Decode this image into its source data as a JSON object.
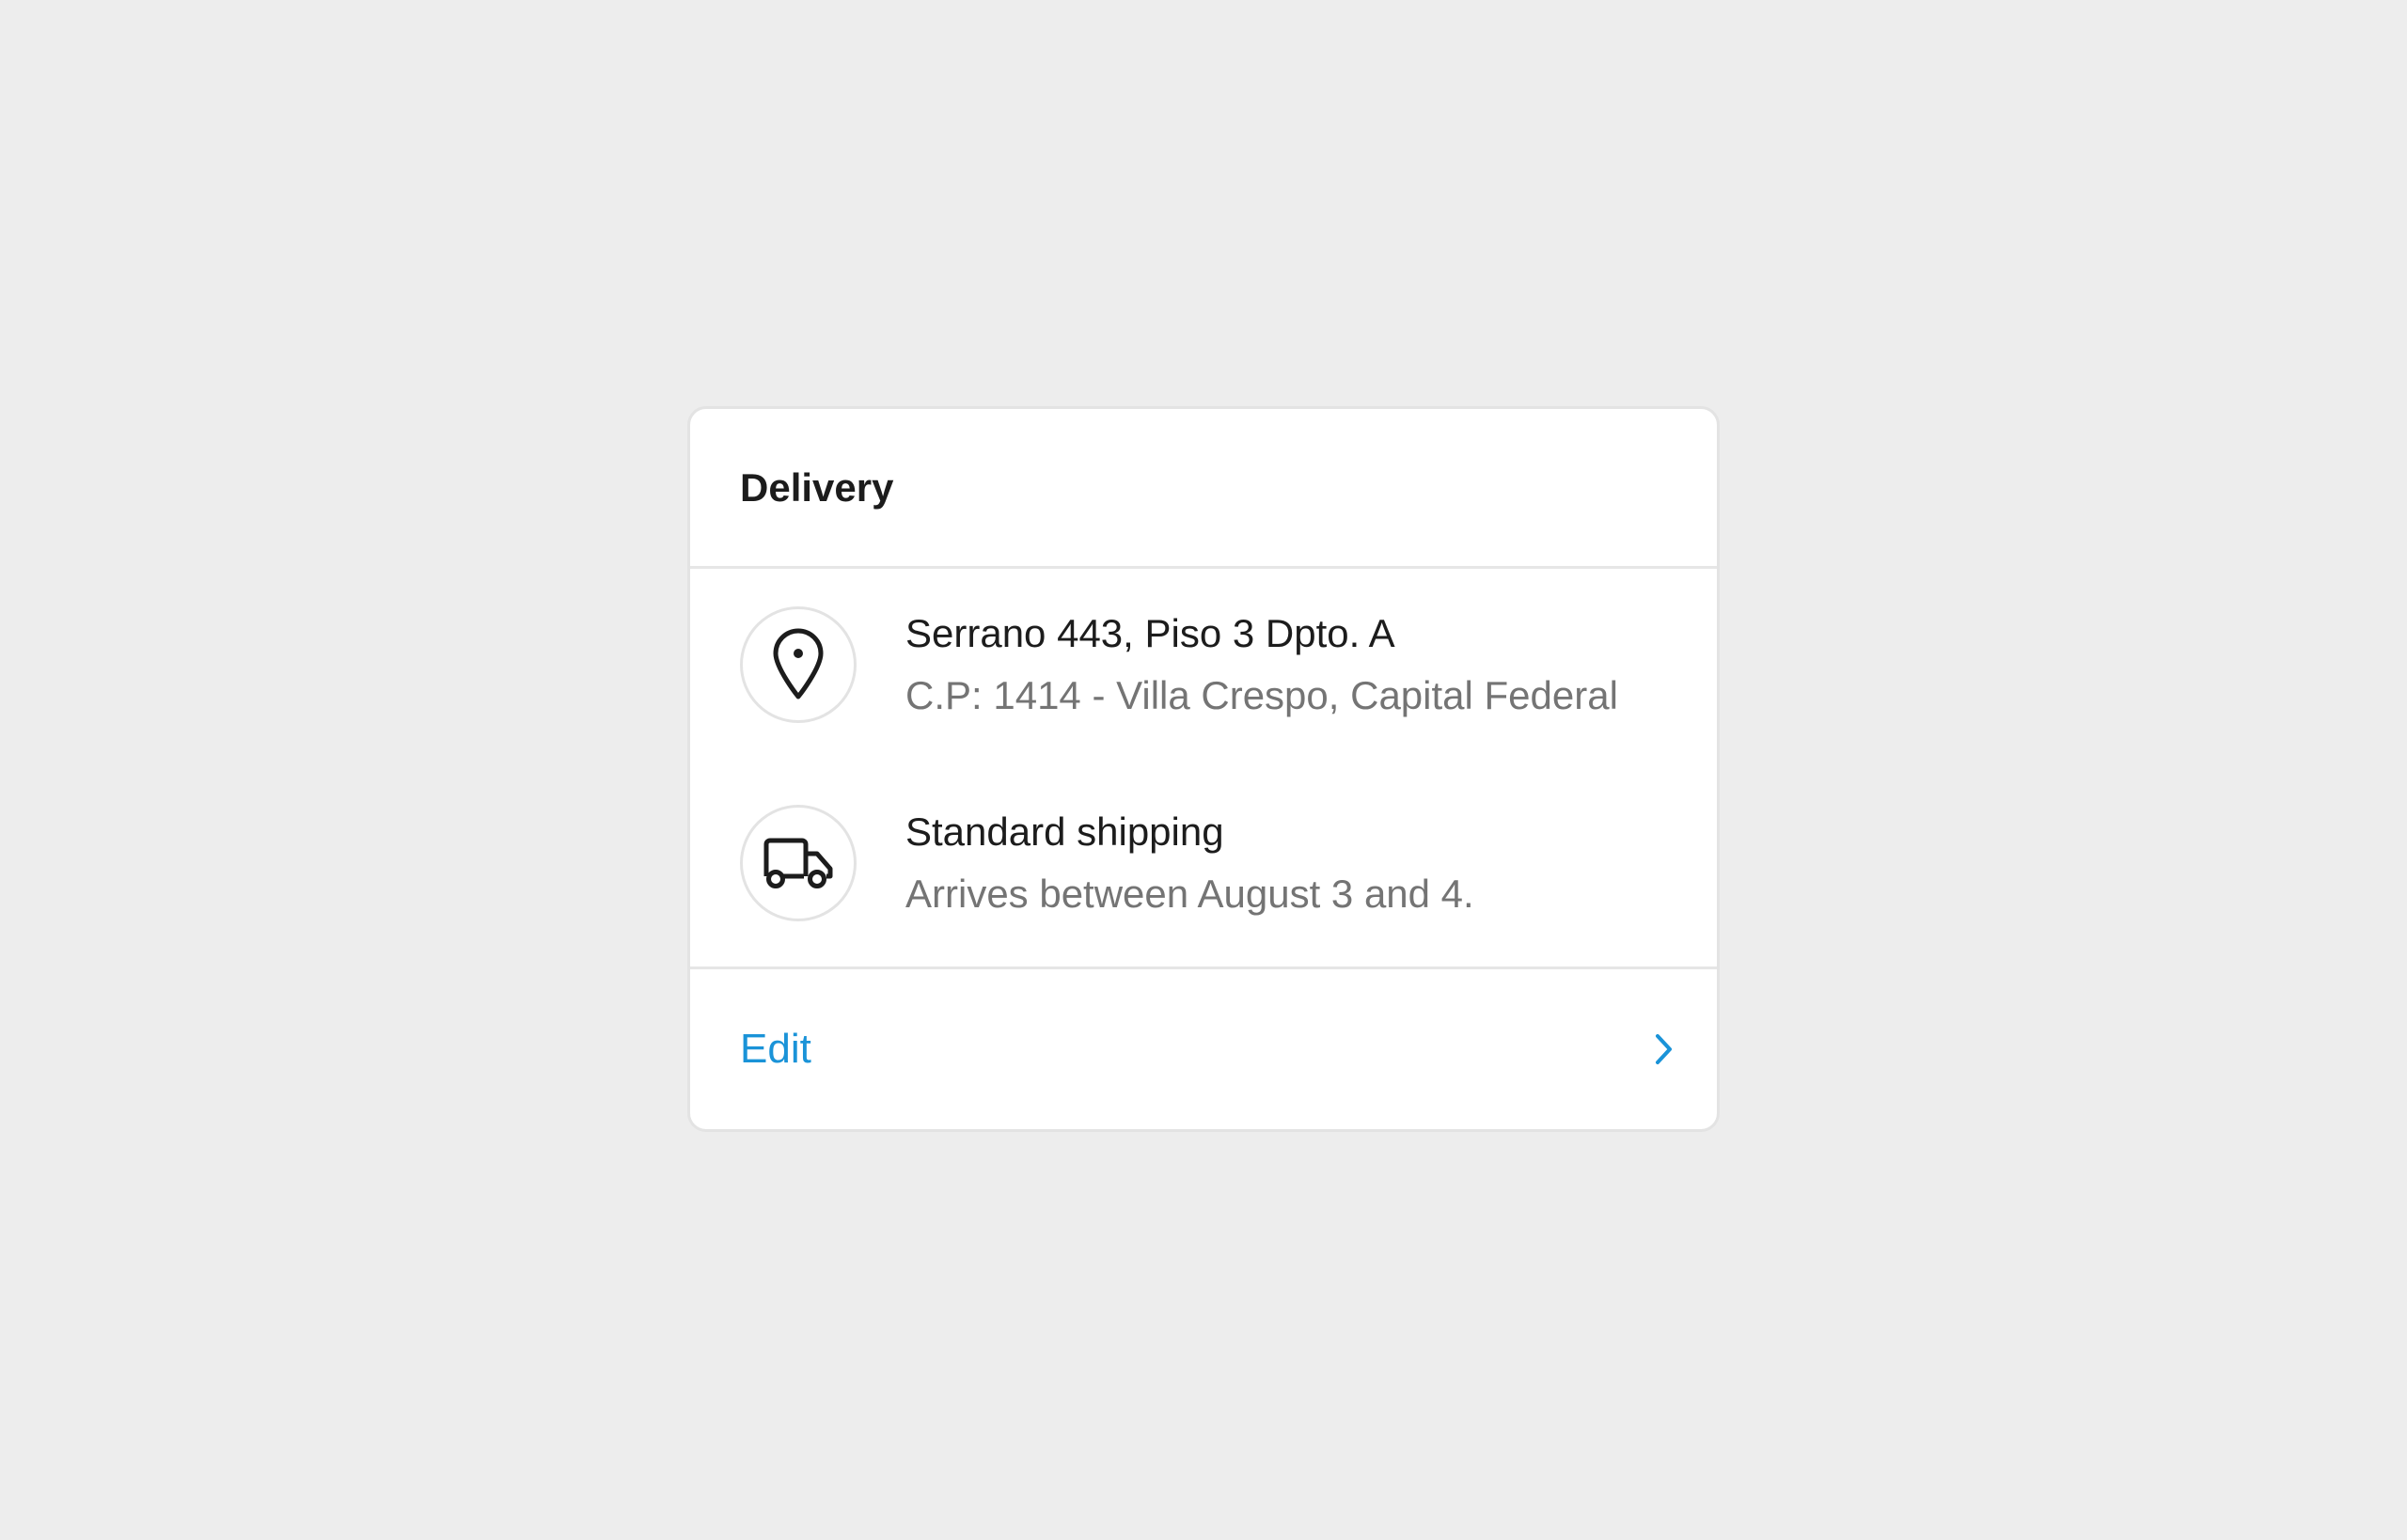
{
  "card": {
    "title": "Delivery",
    "address": {
      "icon": "location-pin-icon",
      "line1": "Serrano 443, Piso 3 Dpto. A",
      "line2": "C.P: 1414 - Villa Crespo, Capital Federal"
    },
    "shipping": {
      "icon": "truck-icon",
      "method": "Standard shipping",
      "eta": "Arrives between August 3 and 4."
    },
    "footer": {
      "edit_label": "Edit",
      "icon": "chevron-right-icon"
    }
  },
  "colors": {
    "page_background": "#ededed",
    "card_background": "#ffffff",
    "primary_text": "#1c1c1c",
    "secondary_text": "#747474",
    "link": "#1a93d8",
    "divider": "#e6e6e6"
  }
}
